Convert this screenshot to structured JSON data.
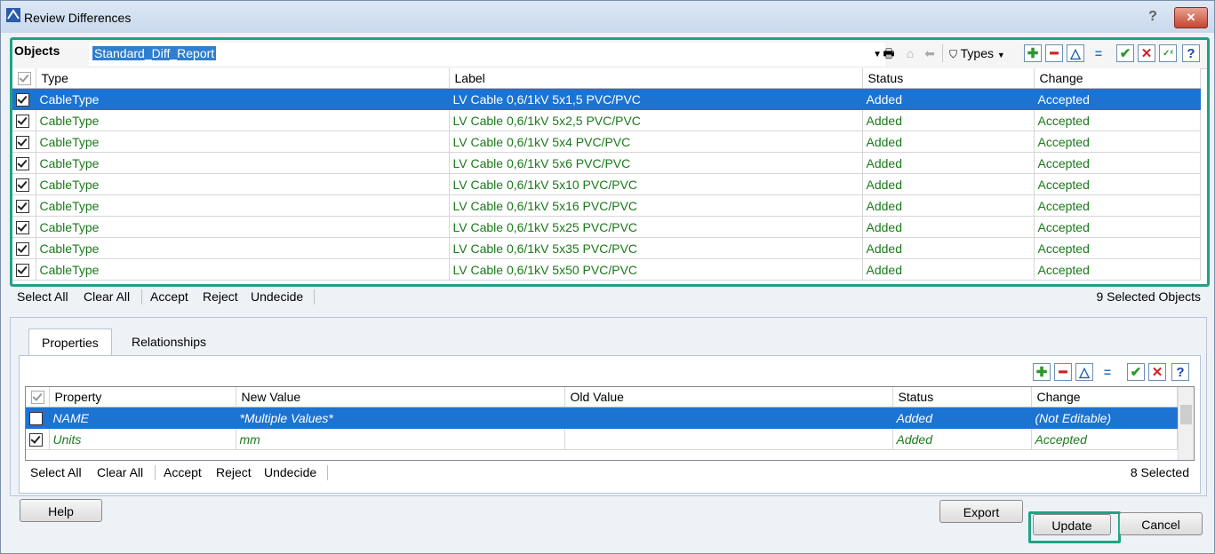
{
  "window": {
    "title": "Review Differences",
    "help": "?",
    "close": "✕"
  },
  "objects": {
    "tab_label": "Objects",
    "report": "Standard_Diff_Report",
    "types_label": "Types",
    "columns": [
      "Type",
      "Label",
      "Status",
      "Change"
    ],
    "rows": [
      {
        "type": "CableType",
        "label": "LV Cable 0,6/1kV 5x1,5 PVC/PVC",
        "status": "Added",
        "change": "Accepted",
        "selected": true
      },
      {
        "type": "CableType",
        "label": "LV Cable 0,6/1kV 5x2,5 PVC/PVC",
        "status": "Added",
        "change": "Accepted"
      },
      {
        "type": "CableType",
        "label": "LV Cable 0,6/1kV 5x4 PVC/PVC",
        "status": "Added",
        "change": "Accepted"
      },
      {
        "type": "CableType",
        "label": "LV Cable 0,6/1kV 5x6 PVC/PVC",
        "status": "Added",
        "change": "Accepted"
      },
      {
        "type": "CableType",
        "label": "LV Cable 0,6/1kV 5x10 PVC/PVC",
        "status": "Added",
        "change": "Accepted"
      },
      {
        "type": "CableType",
        "label": "LV Cable 0,6/1kV 5x16 PVC/PVC",
        "status": "Added",
        "change": "Accepted"
      },
      {
        "type": "CableType",
        "label": "LV Cable 0,6/1kV 5x25 PVC/PVC",
        "status": "Added",
        "change": "Accepted"
      },
      {
        "type": "CableType",
        "label": "LV Cable 0,6/1kV 5x35 PVC/PVC",
        "status": "Added",
        "change": "Accepted"
      },
      {
        "type": "CableType",
        "label": "LV Cable 0,6/1kV 5x50 PVC/PVC",
        "status": "Added",
        "change": "Accepted"
      }
    ],
    "actions": {
      "select_all": "Select All",
      "clear_all": "Clear All",
      "accept": "Accept",
      "reject": "Reject",
      "undecide": "Undecide"
    },
    "selected_count": "9 Selected Objects"
  },
  "details": {
    "tabs": [
      "Properties",
      "Relationships"
    ],
    "columns": [
      "Property",
      "New Value",
      "Old Value",
      "Status",
      "Change"
    ],
    "rows": [
      {
        "property": "NAME",
        "new_value": "*Multiple Values*",
        "old_value": "",
        "status": "Added",
        "change": "(Not Editable)",
        "selected": true,
        "checked": false
      },
      {
        "property": "Units",
        "new_value": "mm",
        "old_value": "",
        "status": "Added",
        "change": "Accepted",
        "checked": true
      }
    ],
    "actions": {
      "select_all": "Select All",
      "clear_all": "Clear All",
      "accept": "Accept",
      "reject": "Reject",
      "undecide": "Undecide"
    },
    "selected_count": "8 Selected"
  },
  "buttons": {
    "help": "Help",
    "export": "Export",
    "update": "Update",
    "cancel": "Cancel"
  },
  "colors": {
    "accent_highlight": "#1ea384",
    "selection": "#1c73d2",
    "accepted_text": "#1a7a1a"
  }
}
